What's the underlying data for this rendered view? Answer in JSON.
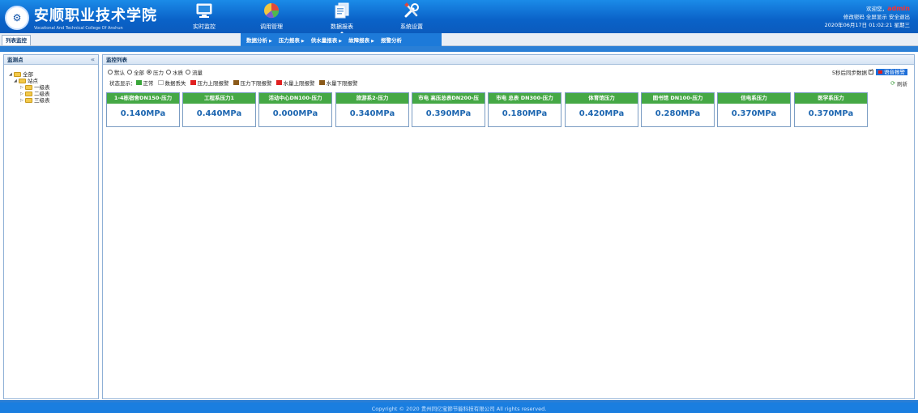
{
  "header": {
    "logo_cn": "安顺职业技术学院",
    "logo_en": "Vocational And Technical College Of Anshun",
    "nav": [
      {
        "label": "实时监控",
        "icon": "monitor-icon"
      },
      {
        "label": "调用管理",
        "icon": "pie-chart-icon"
      },
      {
        "label": "数据报表",
        "icon": "report-icon",
        "active": true
      },
      {
        "label": "系统设置",
        "icon": "tools-icon"
      }
    ],
    "welcome": "欢迎您，",
    "user": "admin",
    "change_password": "修改密码",
    "fullscreen": "全屏显示",
    "logout": "安全退出",
    "datetime": "2020年06月17日 01:02:21 星期三"
  },
  "subbar": {
    "page_tab": "列表监控",
    "reports": [
      "数据分析",
      "压力报表",
      "供水量报表",
      "故障报表",
      "报警分析"
    ]
  },
  "left": {
    "title": "监测点",
    "tree": {
      "root": "全部",
      "station": "站点",
      "levels": [
        "一级表",
        "二级表",
        "三级表"
      ]
    }
  },
  "right": {
    "title": "监控列表",
    "filters": [
      {
        "label": "默认",
        "checked": false
      },
      {
        "label": "全部",
        "checked": false
      },
      {
        "label": "压力",
        "checked": true
      },
      {
        "label": "水质",
        "checked": false
      },
      {
        "label": "流量",
        "checked": false
      }
    ],
    "sync_label": "5秒后同步数据",
    "voice_label": "语音报警",
    "refresh_label": "刷新",
    "legend_title": "状态显示：",
    "legend": [
      {
        "label": "正常",
        "color": "#3aa63a"
      },
      {
        "label": "数据丢失",
        "color": "#ffffff"
      },
      {
        "label": "压力上限报警",
        "color": "#e02020"
      },
      {
        "label": "压力下限报警",
        "color": "#8b5a1a"
      },
      {
        "label": "水量上限报警",
        "color": "#e02020"
      },
      {
        "label": "水量下限报警",
        "color": "#8b5a1a"
      }
    ],
    "cards": [
      {
        "title": "1-4栋宿舍DN150-压力",
        "value": "0.140MPa"
      },
      {
        "title": "工程系压力1",
        "value": "0.440MPa"
      },
      {
        "title": "活动中心DN100-压力",
        "value": "0.000MPa"
      },
      {
        "title": "旅游系2-压力",
        "value": "0.340MPa"
      },
      {
        "title": "市电 高压总表DN200-压",
        "value": "0.390MPa"
      },
      {
        "title": "市电 总表 DN300-压力",
        "value": "0.180MPa"
      },
      {
        "title": "体育馆压力",
        "value": "0.420MPa"
      },
      {
        "title": "图书馆 DN100-压力",
        "value": "0.280MPa"
      },
      {
        "title": "信电系压力",
        "value": "0.370MPa"
      },
      {
        "title": "医学系压力",
        "value": "0.370MPa"
      }
    ]
  },
  "footer": {
    "copyright": "Copyright © 2020 贵州同亿宝節节能科技有限公司 All rights reserved."
  }
}
